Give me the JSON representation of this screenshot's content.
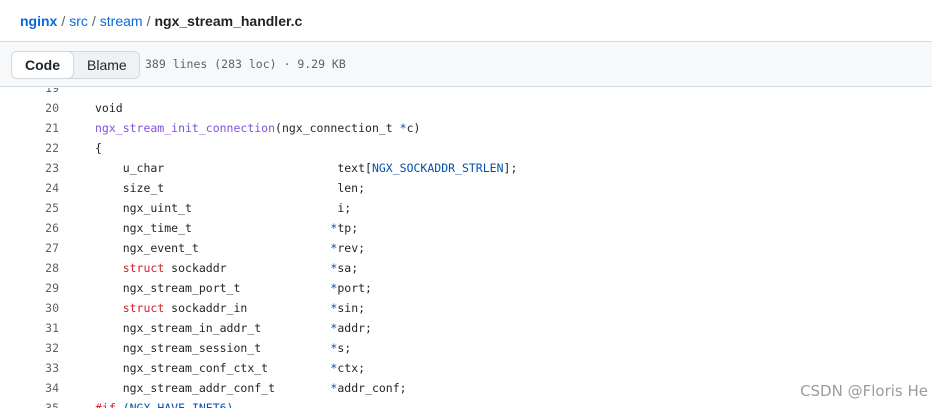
{
  "breadcrumb": {
    "root": "nginx",
    "separator": "/",
    "dir1": "src",
    "dir2": "stream",
    "file": "ngx_stream_handler.c"
  },
  "toolbar": {
    "code_tab": "Code",
    "blame_tab": "Blame",
    "file_info": "389 lines (283 loc) · 9.29 KB"
  },
  "code": {
    "lines": [
      {
        "num": "19"
      },
      {
        "num": "20",
        "segments": [
          {
            "t": "void"
          }
        ]
      },
      {
        "num": "21",
        "segments": [
          {
            "t": "ngx_stream_init_connection",
            "c": "fn"
          },
          {
            "t": "(ngx_connection_t "
          },
          {
            "t": "*",
            "c": "op"
          },
          {
            "t": "c)"
          }
        ]
      },
      {
        "num": "22",
        "segments": [
          {
            "t": "{"
          }
        ]
      },
      {
        "num": "23",
        "segments": [
          {
            "t": "    u_char                         text["
          },
          {
            "t": "NGX_SOCKADDR_STRLEN",
            "c": "const"
          },
          {
            "t": "];"
          }
        ]
      },
      {
        "num": "24",
        "segments": [
          {
            "t": "    size_t                         len;"
          }
        ]
      },
      {
        "num": "25",
        "segments": [
          {
            "t": "    ngx_uint_t                     i;"
          }
        ]
      },
      {
        "num": "26",
        "segments": [
          {
            "t": "    ngx_time_t                    "
          },
          {
            "t": "*",
            "c": "op"
          },
          {
            "t": "tp;"
          }
        ]
      },
      {
        "num": "27",
        "segments": [
          {
            "t": "    ngx_event_t                   "
          },
          {
            "t": "*",
            "c": "op"
          },
          {
            "t": "rev;"
          }
        ]
      },
      {
        "num": "28",
        "segments": [
          {
            "t": "    "
          },
          {
            "t": "struct",
            "c": "kw"
          },
          {
            "t": " sockaddr               "
          },
          {
            "t": "*",
            "c": "op"
          },
          {
            "t": "sa;"
          }
        ]
      },
      {
        "num": "29",
        "segments": [
          {
            "t": "    ngx_stream_port_t             "
          },
          {
            "t": "*",
            "c": "op"
          },
          {
            "t": "port;"
          }
        ]
      },
      {
        "num": "30",
        "segments": [
          {
            "t": "    "
          },
          {
            "t": "struct",
            "c": "kw"
          },
          {
            "t": " sockaddr_in            "
          },
          {
            "t": "*",
            "c": "op"
          },
          {
            "t": "sin;"
          }
        ]
      },
      {
        "num": "31",
        "segments": [
          {
            "t": "    ngx_stream_in_addr_t          "
          },
          {
            "t": "*",
            "c": "op"
          },
          {
            "t": "addr;"
          }
        ]
      },
      {
        "num": "32",
        "segments": [
          {
            "t": "    ngx_stream_session_t          "
          },
          {
            "t": "*",
            "c": "op"
          },
          {
            "t": "s;"
          }
        ]
      },
      {
        "num": "33",
        "segments": [
          {
            "t": "    ngx_stream_conf_ctx_t         "
          },
          {
            "t": "*",
            "c": "op"
          },
          {
            "t": "ctx;"
          }
        ]
      },
      {
        "num": "34",
        "segments": [
          {
            "t": "    ngx_stream_addr_conf_t        "
          },
          {
            "t": "*",
            "c": "op"
          },
          {
            "t": "addr_conf;"
          }
        ]
      },
      {
        "num": "35",
        "segments": [
          {
            "t": "#if",
            "c": "pp"
          },
          {
            "t": " (NGX_HAVE_INET6)",
            "c": "const"
          }
        ]
      }
    ]
  },
  "watermark": "CSDN @Floris He"
}
